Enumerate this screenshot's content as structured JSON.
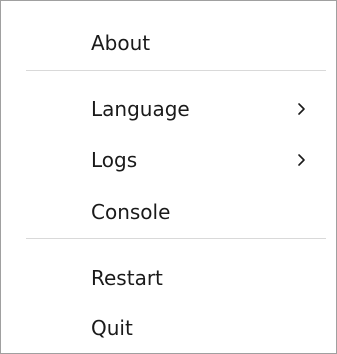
{
  "menu": {
    "items": [
      {
        "label": "About"
      },
      {
        "label": "Language",
        "submenu_icon": "chevron-right-icon"
      },
      {
        "label": "Logs",
        "submenu_icon": "chevron-right-icon"
      },
      {
        "label": "Console"
      },
      {
        "label": "Restart"
      },
      {
        "label": "Quit"
      }
    ]
  },
  "colors": {
    "text": "#1a1a1a",
    "border": "#a0a0a0",
    "separator": "#d9d9d9",
    "background": "#ffffff"
  }
}
